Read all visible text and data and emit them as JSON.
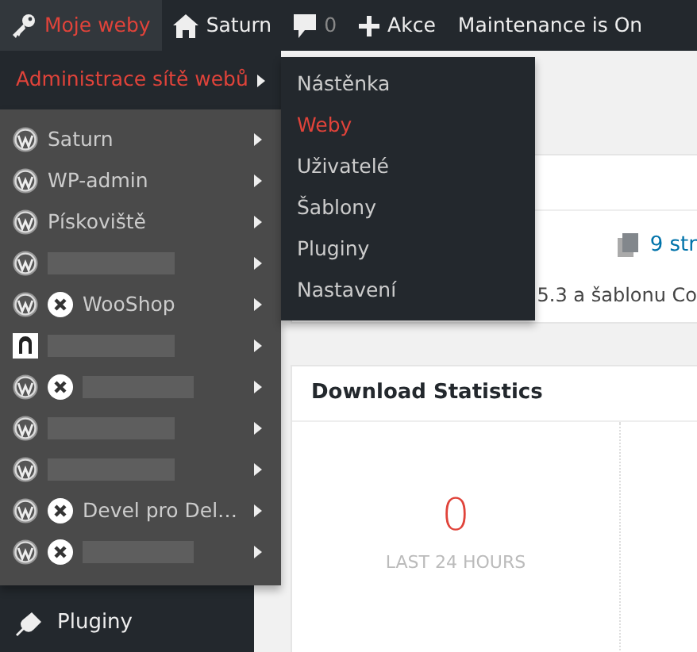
{
  "admin_bar": {
    "items": [
      {
        "kind": "my-sites",
        "label": "Moje weby",
        "selected": true
      },
      {
        "kind": "site",
        "label": "Saturn",
        "selected": false
      },
      {
        "kind": "comments",
        "label": "0",
        "selected": false
      },
      {
        "kind": "new",
        "label": "Akce",
        "selected": false
      },
      {
        "kind": "text",
        "label": "Maintenance is On",
        "selected": false
      }
    ]
  },
  "my_sites_menu": {
    "network_admin": {
      "label": "Administrace sítě webů",
      "expanded": true
    },
    "network_submenu": [
      {
        "label": "Nástěnka",
        "selected": false
      },
      {
        "label": "Weby",
        "selected": true
      },
      {
        "label": "Uživatelé",
        "selected": false
      },
      {
        "label": "Šablony",
        "selected": false
      },
      {
        "label": "Pluginy",
        "selected": false
      },
      {
        "label": "Nastavení",
        "selected": false
      }
    ],
    "sites": [
      {
        "kind": "wordpress",
        "label": "Saturn",
        "redacted": false,
        "closed": false
      },
      {
        "kind": "wordpress",
        "label": "WP-admin",
        "redacted": false,
        "closed": false
      },
      {
        "kind": "wordpress",
        "label": "Pískoviště",
        "redacted": false,
        "closed": false
      },
      {
        "kind": "wordpress",
        "redacted": true,
        "closed": false
      },
      {
        "kind": "wordpress",
        "label": "WooShop",
        "redacted": false,
        "closed": true
      },
      {
        "kind": "custom",
        "redacted": true,
        "closed": false
      },
      {
        "kind": "wordpress",
        "redacted": true,
        "closed": true
      },
      {
        "kind": "wordpress",
        "redacted": true,
        "closed": false
      },
      {
        "kind": "wordpress",
        "redacted": true,
        "closed": false
      },
      {
        "kind": "wordpress",
        "label": "Devel pro Del…",
        "redacted": false,
        "closed": true
      },
      {
        "kind": "wordpress",
        "redacted": true,
        "closed": true
      }
    ]
  },
  "sidebar": {
    "items": [
      {
        "label": "Pluginy"
      }
    ]
  },
  "content": {
    "overview_card": {
      "pages_link": "9 str",
      "theme_text": "5.3 a šablonu Co"
    },
    "download_statistics": {
      "title": "Download Statistics",
      "value": "0",
      "period": "LAST 24 HOURS"
    }
  }
}
